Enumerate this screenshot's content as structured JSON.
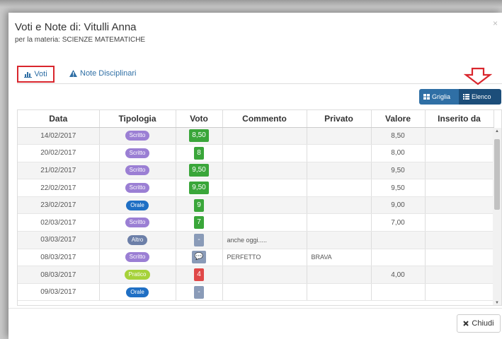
{
  "modal": {
    "title": "Voti e Note di: Vitulli Anna",
    "subtitle": "per la materia: SCIENZE MATEMATICHE",
    "close_glyph": "×"
  },
  "tabs": {
    "voti_label": "Voti",
    "note_label": "Note Disciplinari"
  },
  "view_buttons": {
    "griglia_label": "Griglia",
    "elenco_label": "Elenco"
  },
  "table": {
    "headers": [
      "Data",
      "Tipologia",
      "Voto",
      "Commento",
      "Privato",
      "Valore",
      "Inserito da"
    ],
    "rows": [
      {
        "data": "14/02/2017",
        "tipologia": "Scritto",
        "tipo_color": "#9b7fd4",
        "voto": "8,50",
        "voto_color": "#3aa63a",
        "commento": "",
        "privato": "",
        "valore": "8,50",
        "inserito": ""
      },
      {
        "data": "20/02/2017",
        "tipologia": "Scritto",
        "tipo_color": "#9b7fd4",
        "voto": "8",
        "voto_color": "#3aa63a",
        "commento": "",
        "privato": "",
        "valore": "8,00",
        "inserito": ""
      },
      {
        "data": "21/02/2017",
        "tipologia": "Scritto",
        "tipo_color": "#9b7fd4",
        "voto": "9,50",
        "voto_color": "#3aa63a",
        "commento": "",
        "privato": "",
        "valore": "9,50",
        "inserito": ""
      },
      {
        "data": "22/02/2017",
        "tipologia": "Scritto",
        "tipo_color": "#9b7fd4",
        "voto": "9,50",
        "voto_color": "#3aa63a",
        "commento": "",
        "privato": "",
        "valore": "9,50",
        "inserito": ""
      },
      {
        "data": "23/02/2017",
        "tipologia": "Orale",
        "tipo_color": "#1f6fc4",
        "voto": "9",
        "voto_color": "#3aa63a",
        "commento": "",
        "privato": "",
        "valore": "9,00",
        "inserito": ""
      },
      {
        "data": "02/03/2017",
        "tipologia": "Scritto",
        "tipo_color": "#9b7fd4",
        "voto": "7",
        "voto_color": "#3aa63a",
        "commento": "",
        "privato": "",
        "valore": "7,00",
        "inserito": ""
      },
      {
        "data": "03/03/2017",
        "tipologia": "Altro",
        "tipo_color": "#6c7fa8",
        "voto": "-",
        "voto_color": "#8a9bb8",
        "commento": "anche oggi.....",
        "privato": "",
        "valore": "",
        "inserito": ""
      },
      {
        "data": "08/03/2017",
        "tipologia": "Scritto",
        "tipo_color": "#9b7fd4",
        "voto": "💬",
        "voto_color": "#8a9bb8",
        "commento": "PERFETTO",
        "privato": "BRAVA",
        "valore": "",
        "inserito": ""
      },
      {
        "data": "08/03/2017",
        "tipologia": "Pratico",
        "tipo_color": "#a6d23a",
        "voto": "4",
        "voto_color": "#e04848",
        "commento": "",
        "privato": "",
        "valore": "4,00",
        "inserito": ""
      },
      {
        "data": "09/03/2017",
        "tipologia": "Orale",
        "tipo_color": "#1f6fc4",
        "voto": "-",
        "voto_color": "#8a9bb8",
        "commento": "",
        "privato": "",
        "valore": "",
        "inserito": ""
      }
    ]
  },
  "footer": {
    "chiudi_label": "Chiudi"
  },
  "colors": {
    "accent": "#2f6fa5",
    "highlight_red": "#d9262d"
  },
  "icons": {
    "voti": "bar-chart-icon",
    "note": "warning-icon",
    "griglia": "grid-icon",
    "elenco": "list-icon",
    "chiudi": "close-icon",
    "annotation": "down-arrow-annotation"
  }
}
